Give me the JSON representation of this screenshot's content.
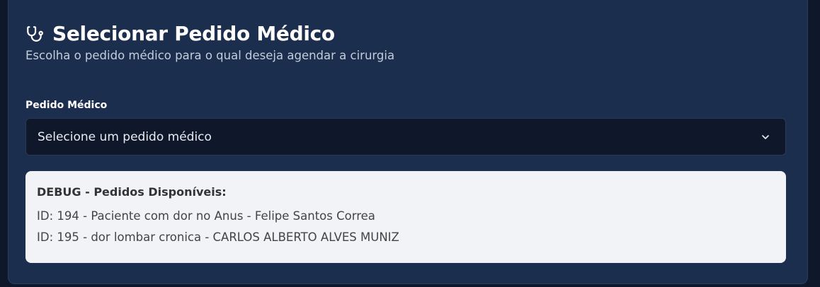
{
  "header": {
    "title": "Selecionar Pedido Médico",
    "subtitle": "Escolha o pedido médico para o qual deseja agendar a cirurgia",
    "icon": "stethoscope-icon"
  },
  "form": {
    "label": "Pedido Médico",
    "select_value": "Selecione um pedido médico",
    "select_icon": "chevron-down-icon"
  },
  "debug": {
    "title": "DEBUG - Pedidos Disponíveis:",
    "items": [
      "ID: 194 - Paciente com dor no Anus - Felipe Santos Correa",
      "ID: 195 - dor lombar cronica - CARLOS ALBERTO ALVES MUNIZ"
    ]
  },
  "colors": {
    "page_bg": "#0f172a",
    "card_bg": "#1c2e4d",
    "select_bg": "#0f172a",
    "debug_bg": "#f1f3f6"
  }
}
